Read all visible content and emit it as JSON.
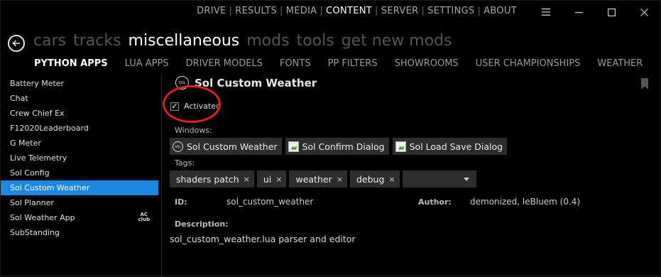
{
  "topnav": {
    "items": [
      {
        "label": "DRIVE"
      },
      {
        "label": "RESULTS"
      },
      {
        "label": "MEDIA"
      },
      {
        "label": "CONTENT",
        "active": true
      },
      {
        "label": "SERVER"
      },
      {
        "label": "SETTINGS"
      },
      {
        "label": "ABOUT"
      }
    ],
    "separator": "|"
  },
  "window_controls": {
    "menu": "☰",
    "minimize": "—",
    "maximize": "☐",
    "close": "✕"
  },
  "back": {
    "icon": "←"
  },
  "categories": [
    {
      "label": "cars"
    },
    {
      "label": "tracks"
    },
    {
      "label": "miscellaneous",
      "active": true
    },
    {
      "label": "mods"
    },
    {
      "label": "tools"
    },
    {
      "label": "get new mods"
    }
  ],
  "subtabs": [
    {
      "label": "PYTHON APPS",
      "active": true
    },
    {
      "label": "LUA APPS"
    },
    {
      "label": "DRIVER MODELS"
    },
    {
      "label": "FONTS"
    },
    {
      "label": "PP FILTERS"
    },
    {
      "label": "SHOWROOMS"
    },
    {
      "label": "USER CHAMPIONSHIPS"
    },
    {
      "label": "WEATHER"
    }
  ],
  "sidebar": {
    "items": [
      {
        "label": "Battery Meter"
      },
      {
        "label": "Chat"
      },
      {
        "label": "Crew Chief Ex"
      },
      {
        "label": "F12020Leaderboard"
      },
      {
        "label": "G Meter"
      },
      {
        "label": "Live Telemetry"
      },
      {
        "label": "Sol Config"
      },
      {
        "label": "Sol Custom Weather",
        "selected": true
      },
      {
        "label": "Sol Planner"
      },
      {
        "label": "Sol Weather App",
        "badge_line1": "AC",
        "badge_line2": "club"
      },
      {
        "label": "SubStanding"
      }
    ]
  },
  "detail": {
    "logo_text": "SOL",
    "title": "Sol Custom Weather",
    "activated_label": "Activated",
    "activated_checked": true,
    "check_mark": "✓",
    "windows_label": "Windows:",
    "windows": [
      {
        "label": "Sol Custom Weather",
        "icon": "sol-logo-icon"
      },
      {
        "label": "Sol Confirm Dialog",
        "icon": "broken-image-icon"
      },
      {
        "label": "Sol Load Save Dialog",
        "icon": "broken-image-icon"
      }
    ],
    "tags_label": "Tags:",
    "tags": [
      {
        "label": "shaders patch"
      },
      {
        "label": "ui"
      },
      {
        "label": "weather"
      },
      {
        "label": "debug"
      }
    ],
    "tag_remove": "×",
    "id_label": "ID:",
    "id_value": "sol_custom_weather",
    "author_label": "Author:",
    "author_value": "demonized, leBluem (0.4)",
    "description_label": "Description:",
    "description_value": "sol_custom_weather.lua parser and editor"
  },
  "colors": {
    "accent": "#1c88e2",
    "highlight": "#e01f1f",
    "background": "#000000"
  }
}
